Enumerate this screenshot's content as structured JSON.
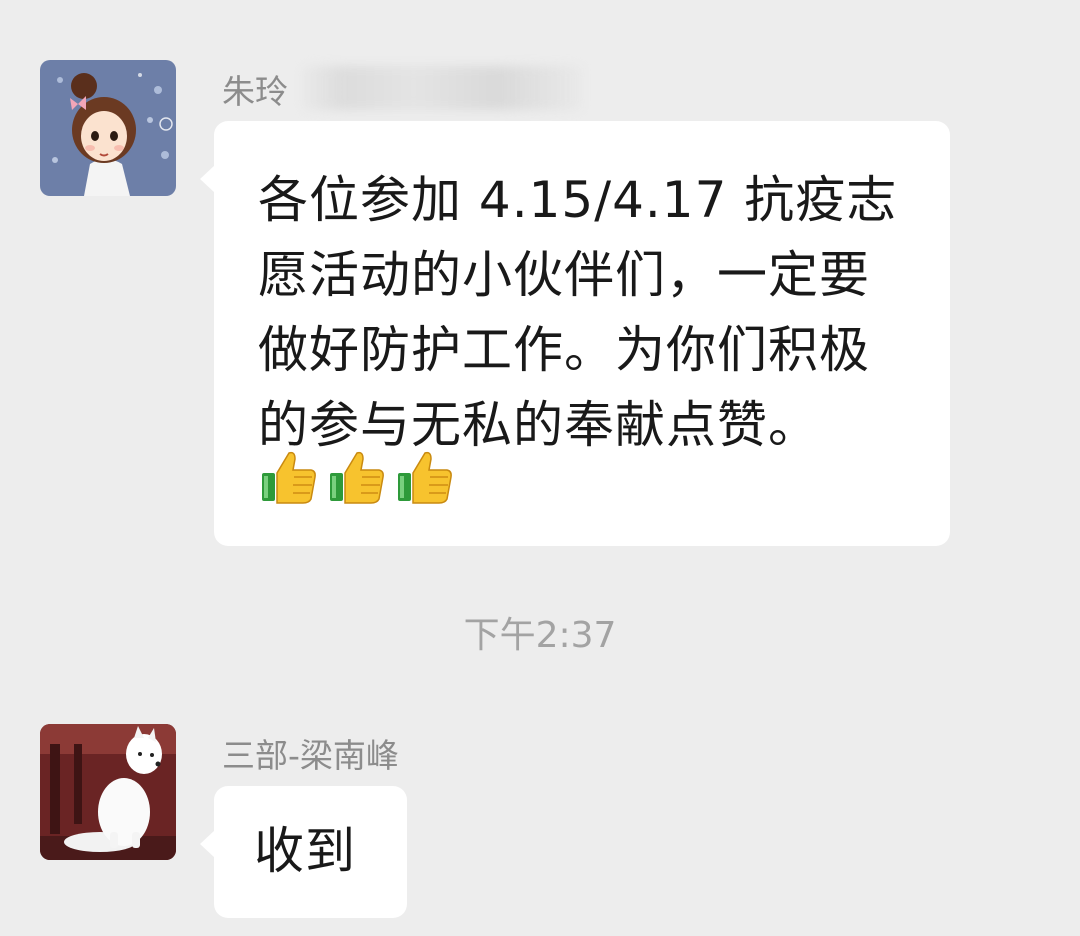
{
  "messages": [
    {
      "sender": "朱玲",
      "sender_redacted": true,
      "avatar_icon": "cartoon-girl-avatar-icon",
      "text": "各位参加 4.15/4.17 抗疫志\n愿活动的小伙伴们，一定要\n做好防护工作。为你们积极\n的参与无私的奉献点赞。",
      "emojis": [
        "thumbs-up-icon",
        "thumbs-up-icon",
        "thumbs-up-icon"
      ]
    },
    {
      "sender": "三部-梁南峰",
      "avatar_icon": "white-dog-avatar-icon",
      "text": "收到"
    }
  ],
  "timestamp": "下午2:37",
  "colors": {
    "background": "#ededed",
    "bubble": "#ffffff",
    "name": "#8c8c8c",
    "timestamp": "#a3a3a3"
  }
}
